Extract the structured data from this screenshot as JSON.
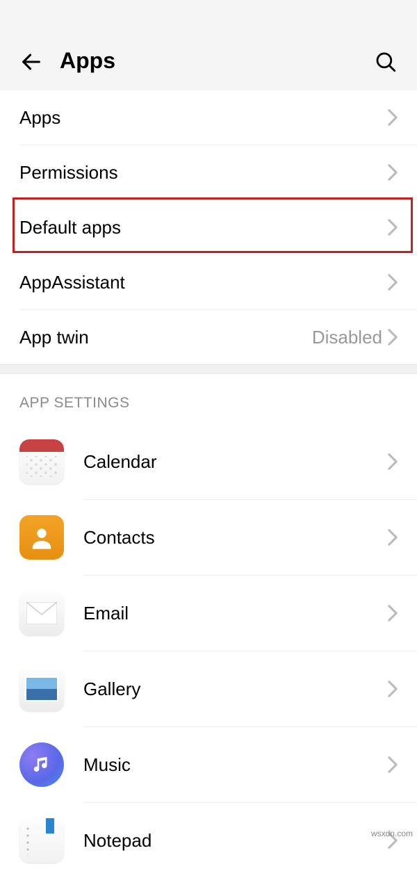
{
  "header": {
    "title": "Apps"
  },
  "menu": {
    "items": [
      {
        "label": "Apps",
        "value": ""
      },
      {
        "label": "Permissions",
        "value": ""
      },
      {
        "label": "Default apps",
        "value": ""
      },
      {
        "label": "AppAssistant",
        "value": ""
      },
      {
        "label": "App twin",
        "value": "Disabled"
      }
    ]
  },
  "appSettings": {
    "header": "APP SETTINGS",
    "items": [
      {
        "label": "Calendar",
        "icon": "calendar-icon"
      },
      {
        "label": "Contacts",
        "icon": "contacts-icon"
      },
      {
        "label": "Email",
        "icon": "email-icon"
      },
      {
        "label": "Gallery",
        "icon": "gallery-icon"
      },
      {
        "label": "Music",
        "icon": "music-icon"
      },
      {
        "label": "Notepad",
        "icon": "notepad-icon"
      }
    ]
  },
  "watermark": "wsxdn.com"
}
